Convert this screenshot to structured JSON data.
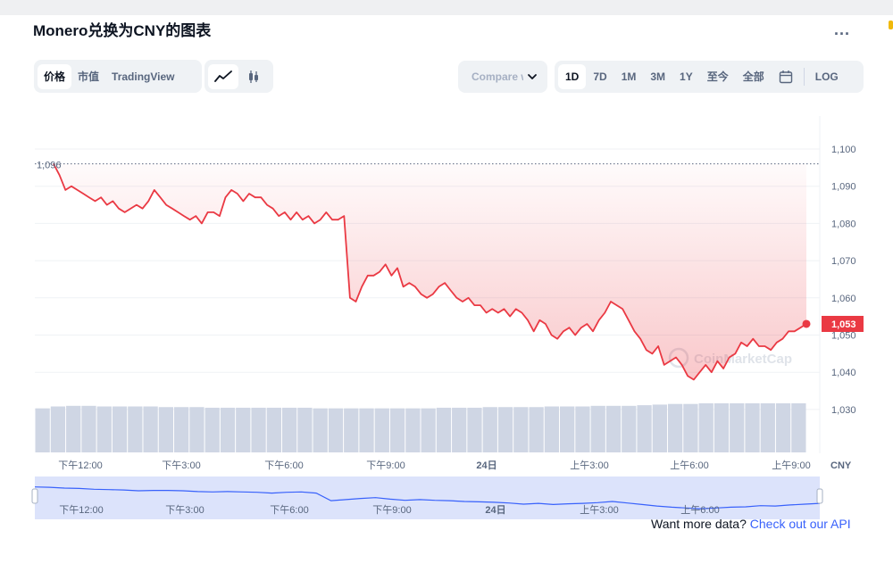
{
  "title": "Monero兑换为CNY的图表",
  "more_label": "...",
  "view_tabs": [
    "价格",
    "市值",
    "TradingView"
  ],
  "chart_style": [
    "line-chart-icon",
    "candlestick-icon"
  ],
  "compare_label": "Compare with",
  "ranges": [
    "1D",
    "7D",
    "1M",
    "3M",
    "1Y",
    "至今",
    "全部"
  ],
  "calendar_icon": "calendar-icon",
  "log_label": "LOG",
  "api": {
    "text": "Want more data?",
    "link": "Check out our API"
  },
  "watermark": "CoinMarketCap",
  "colors": {
    "line": "#ea3943",
    "accent": "#3861fb",
    "nav_fill": "#dce3fb"
  },
  "chart_data": {
    "type": "area",
    "currency": "CNY",
    "ylim": [
      1020,
      1105
    ],
    "yticks": [
      "1,100",
      "1,090",
      "1,080",
      "1,070",
      "1,060",
      "1,050",
      "1,040",
      "1,030"
    ],
    "xticks": [
      "下午12:00",
      "下午3:00",
      "下午6:00",
      "下午9:00",
      "24日",
      "上午3:00",
      "上午6:00",
      "上午9:00"
    ],
    "open_value_label": "1,096",
    "open_value": 1096,
    "current_value_label": "1,053",
    "current_value": 1053,
    "series": [
      {
        "values": [
          1096,
          1093,
          1089,
          1090,
          1089,
          1088,
          1087,
          1086,
          1087,
          1085,
          1086,
          1084,
          1083,
          1084,
          1085,
          1084,
          1086,
          1089,
          1087,
          1085,
          1084,
          1083,
          1082,
          1081,
          1082,
          1080,
          1083,
          1083,
          1082,
          1087,
          1089,
          1088,
          1086,
          1088,
          1087,
          1087,
          1085,
          1084,
          1082,
          1083,
          1081,
          1083,
          1081,
          1082,
          1080,
          1081,
          1083,
          1081,
          1081,
          1082,
          1060,
          1059,
          1063,
          1066,
          1066,
          1067,
          1069,
          1066,
          1068,
          1063,
          1064,
          1063,
          1061,
          1060,
          1061,
          1063,
          1064,
          1062,
          1060,
          1059,
          1060,
          1058,
          1058,
          1056,
          1057,
          1056,
          1057,
          1055,
          1057,
          1056,
          1054,
          1051,
          1054,
          1053,
          1050,
          1049,
          1051,
          1052,
          1050,
          1052,
          1053,
          1051,
          1054,
          1056,
          1059,
          1058,
          1057,
          1054,
          1051,
          1049,
          1046,
          1045,
          1047,
          1042,
          1043,
          1044,
          1042,
          1039,
          1038,
          1040,
          1042,
          1040,
          1043,
          1041,
          1044,
          1045,
          1048,
          1047,
          1049,
          1047,
          1047,
          1046,
          1048,
          1049,
          1051,
          1051,
          1052,
          1053
        ]
      }
    ],
    "navigator_values": [
      1096,
      1095,
      1093,
      1092,
      1090,
      1089,
      1088,
      1086,
      1087,
      1087,
      1086,
      1084,
      1083,
      1084,
      1083,
      1082,
      1080,
      1082,
      1083,
      1080,
      1060,
      1063,
      1066,
      1068,
      1064,
      1061,
      1063,
      1061,
      1060,
      1058,
      1057,
      1056,
      1054,
      1051,
      1053,
      1050,
      1052,
      1053,
      1055,
      1058,
      1054,
      1050,
      1046,
      1043,
      1041,
      1039,
      1041,
      1043,
      1044,
      1047,
      1046,
      1049,
      1051,
      1053
    ],
    "volume": {
      "values": [
        70,
        73,
        74,
        74,
        73,
        73,
        73,
        73,
        72,
        72,
        72,
        71,
        71,
        71,
        71,
        71,
        71,
        71,
        70,
        70,
        70,
        70,
        70,
        70,
        70,
        70,
        71,
        71,
        71,
        72,
        72,
        72,
        72,
        73,
        73,
        73,
        74,
        74,
        74,
        75,
        76,
        77,
        77,
        78,
        78,
        78,
        78,
        78,
        78,
        78
      ]
    }
  }
}
